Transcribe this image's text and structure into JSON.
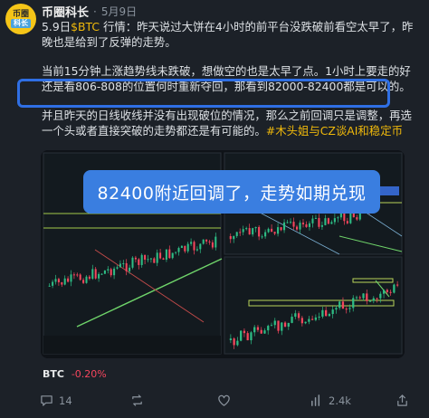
{
  "post": {
    "username": "币圈科长",
    "dot": "·",
    "date": "5月9日",
    "avatar_text_top": "币圈",
    "avatar_text_bottom": "科长",
    "p1_prefix": "5.9日",
    "p1_cashtag": "$BTC",
    "p1_rest": " 行情：昨天说过大饼在4小时的前平台没跌破前看空太早了，昨晚也是给到了反弹的走势。",
    "p2": "当前15分钟上涨趋势线未跌破，想做空的也是太早了点。1小时上要走的好还是看806-808的位置何时重新夺回，那看到82000-82400都是可以的。",
    "p3_text": "并且昨天的日线收线并没有出现破位的情况，那么之前回调只是调整，再选一个头或者直接突破的走势都还是有可能的。",
    "p3_hashtag": "#木头姐与CZ谈AI和稳定币",
    "image_overlay_text": "82400附近回调了，走势如期兑现",
    "ticker_symbol": "BTC",
    "ticker_change": "-0.20%"
  },
  "actions": {
    "reply_count": "14",
    "repost_count": "",
    "like_count": "",
    "views_count": "2.4k"
  },
  "icons": [
    "reply-icon",
    "repost-icon",
    "like-icon",
    "views-icon",
    "share-icon"
  ],
  "colors": {
    "accent": "#f0b90b",
    "highlight": "#2f6fe4",
    "negative": "#f6465d",
    "up_candle": "#2ebd85",
    "down_candle": "#f6465d"
  }
}
